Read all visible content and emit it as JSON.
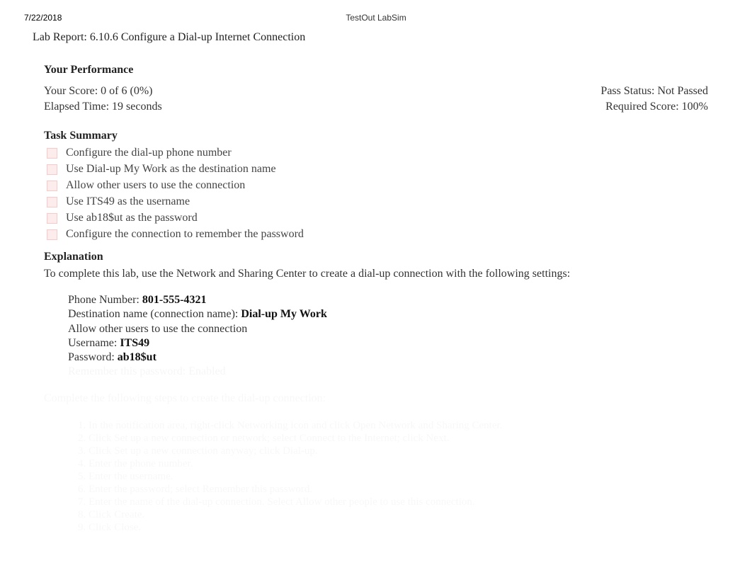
{
  "header": {
    "date": "7/22/2018",
    "app_title": "TestOut LabSim"
  },
  "report_title": "Lab Report: 6.10.6 Configure a Dial-up Internet Connection",
  "performance": {
    "heading": "Your Performance",
    "score_label": "Your Score: 0 of 6 (0%)",
    "pass_status": "Pass Status: Not Passed",
    "elapsed": "Elapsed Time: 19 seconds",
    "required": "Required Score: 100%"
  },
  "task_summary": {
    "heading": "Task Summary",
    "tasks": [
      "Configure the dial-up phone number",
      "Use Dial-up My Work as the destination name",
      "Allow other users to use the connection",
      "Use ITS49 as the username",
      "Use ab18$ut as the password",
      "Configure the connection to remember the password"
    ]
  },
  "explanation": {
    "heading": "Explanation",
    "intro": "To complete this lab, use the Network and Sharing Center to create a dial-up connection with the following settings:",
    "settings": {
      "phone_label": "Phone Number: ",
      "phone_value": "801-555-4321",
      "dest_label": "Destination name (connection name): ",
      "dest_value": "Dial-up My Work",
      "allow": "Allow other users to use the connection",
      "user_label": "Username: ",
      "user_value": "ITS49",
      "pass_label": "Password: ",
      "pass_value": "ab18$ut",
      "remember": "Remember this password: Enabled"
    },
    "steps_intro": "Complete the following steps to create the dial-up connection:",
    "steps": [
      "1. In the notification area, right-click Networking icon and click Open Network and Sharing Center.",
      "2. Click Set up a new connection or network; select Connect to the Internet; click Next.",
      "3. Click Set up a new connection anyway; click Dial-up.",
      "4. Enter the phone number.",
      "5. Enter the username.",
      "6. Enter the password; select Remember this password.",
      "7. Enter the name of the dial-up connection. Select Allow other people to use this connection.",
      "8. Click Create.",
      "9. Click Close."
    ]
  }
}
